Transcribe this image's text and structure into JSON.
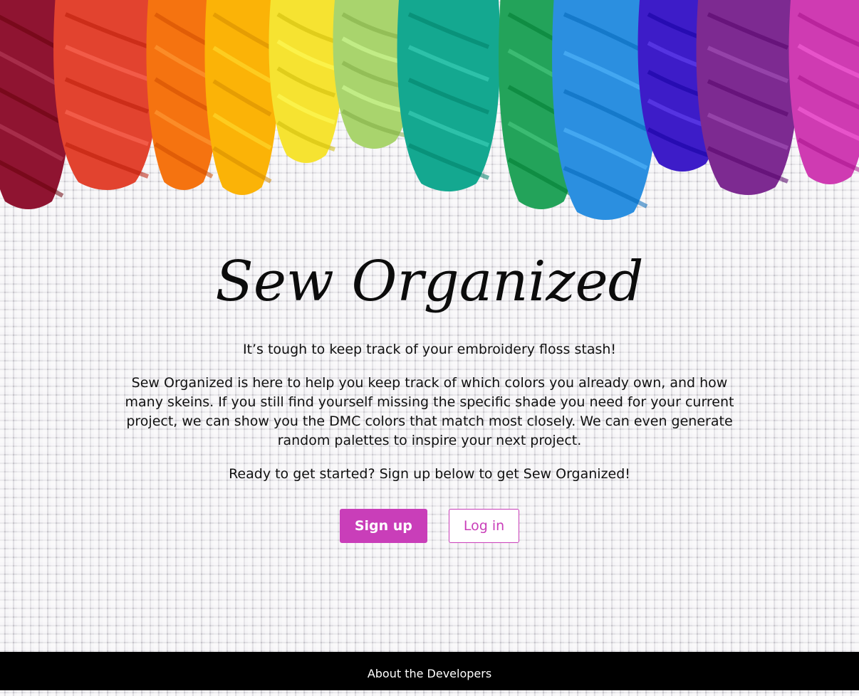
{
  "header": {
    "title": "Sew Organized",
    "floss_colors": [
      "#8f1431",
      "#e2432f",
      "#f57310",
      "#fbb307",
      "#f6e331",
      "#a9d46d",
      "#14a890",
      "#23a35a",
      "#2b8fe0",
      "#3d1cc8",
      "#7d2a91",
      "#cf3bb2"
    ]
  },
  "main": {
    "tagline": "It’s tough to keep track of your embroidery floss stash!",
    "description": "Sew Organized is here to help you keep track of which colors you already own, and how many skeins. If you still find yourself missing the specific shade you need for your current project, we can show you the DMC colors that match most closely. We can even generate random palettes to inspire your next project.",
    "cta": "Ready to get started? Sign up below to get Sew Organized!",
    "signup_label": "Sign up",
    "login_label": "Log in",
    "accent_color": "#c93eb9"
  },
  "footer": {
    "link_label": "About the Developers"
  }
}
